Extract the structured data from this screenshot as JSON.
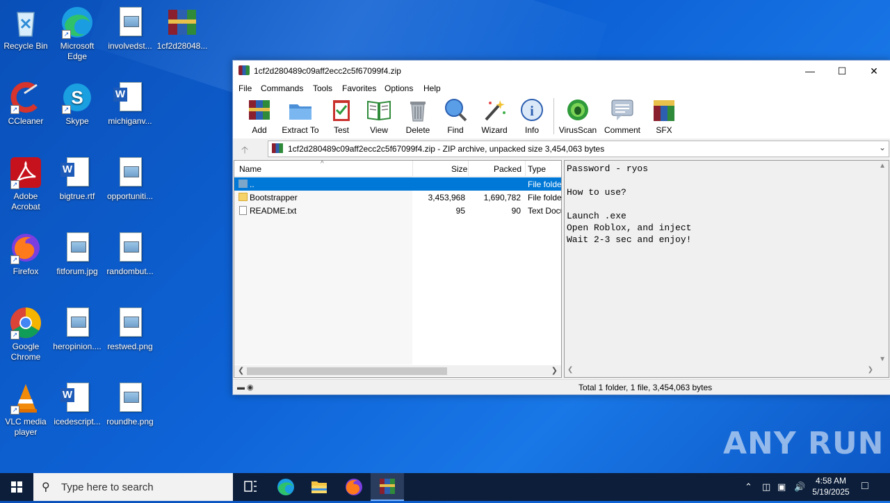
{
  "desktop": {
    "icons": [
      {
        "label": "Recycle Bin"
      },
      {
        "label": "Microsoft Edge"
      },
      {
        "label": "involvedst..."
      },
      {
        "label": "1cf2d28048..."
      },
      {
        "label": "CCleaner"
      },
      {
        "label": "Skype"
      },
      {
        "label": "michiganv..."
      },
      {
        "label": "Adobe Acrobat"
      },
      {
        "label": "bigtrue.rtf"
      },
      {
        "label": "opportuniti..."
      },
      {
        "label": "Firefox"
      },
      {
        "label": "fitforum.jpg"
      },
      {
        "label": "randombut..."
      },
      {
        "label": "Google Chrome"
      },
      {
        "label": "heropinion...."
      },
      {
        "label": "restwed.png"
      },
      {
        "label": "VLC media player"
      },
      {
        "label": "icedescript..."
      },
      {
        "label": "roundhe.png"
      }
    ]
  },
  "window": {
    "title": "1cf2d280489c09aff2ecc2c5f67099f4.zip",
    "menu": [
      "File",
      "Commands",
      "Tools",
      "Favorites",
      "Options",
      "Help"
    ],
    "toolbar": [
      "Add",
      "Extract To",
      "Test",
      "View",
      "Delete",
      "Find",
      "Wizard",
      "Info",
      "VirusScan",
      "Comment",
      "SFX"
    ],
    "address": "1cf2d280489c09aff2ecc2c5f67099f4.zip - ZIP archive, unpacked size 3,454,063 bytes",
    "columns": {
      "name": "Name",
      "size": "Size",
      "packed": "Packed",
      "type": "Type"
    },
    "rows": [
      {
        "name": "..",
        "size": "",
        "packed": "",
        "type": "File folder"
      },
      {
        "name": "Bootstrapper",
        "size": "3,453,968",
        "packed": "1,690,782",
        "type": "File folder"
      },
      {
        "name": "README.txt",
        "size": "95",
        "packed": "90",
        "type": "Text Document"
      }
    ],
    "preview_text": "Password - ryos\n\nHow to use?\n\nLaunch .exe\nOpen Roblox, and inject\nWait 2-3 sec and enjoy!",
    "status": "Total 1 folder, 1 file, 3,454,063 bytes"
  },
  "taskbar": {
    "search_placeholder": "Type here to search",
    "time": "4:58 AM",
    "date": "5/19/2025"
  },
  "watermark": "ANY RUN",
  "colors": {
    "selection": "#0078d7",
    "taskbar": "#0c1e3a",
    "desktop": "#0e63d6"
  }
}
